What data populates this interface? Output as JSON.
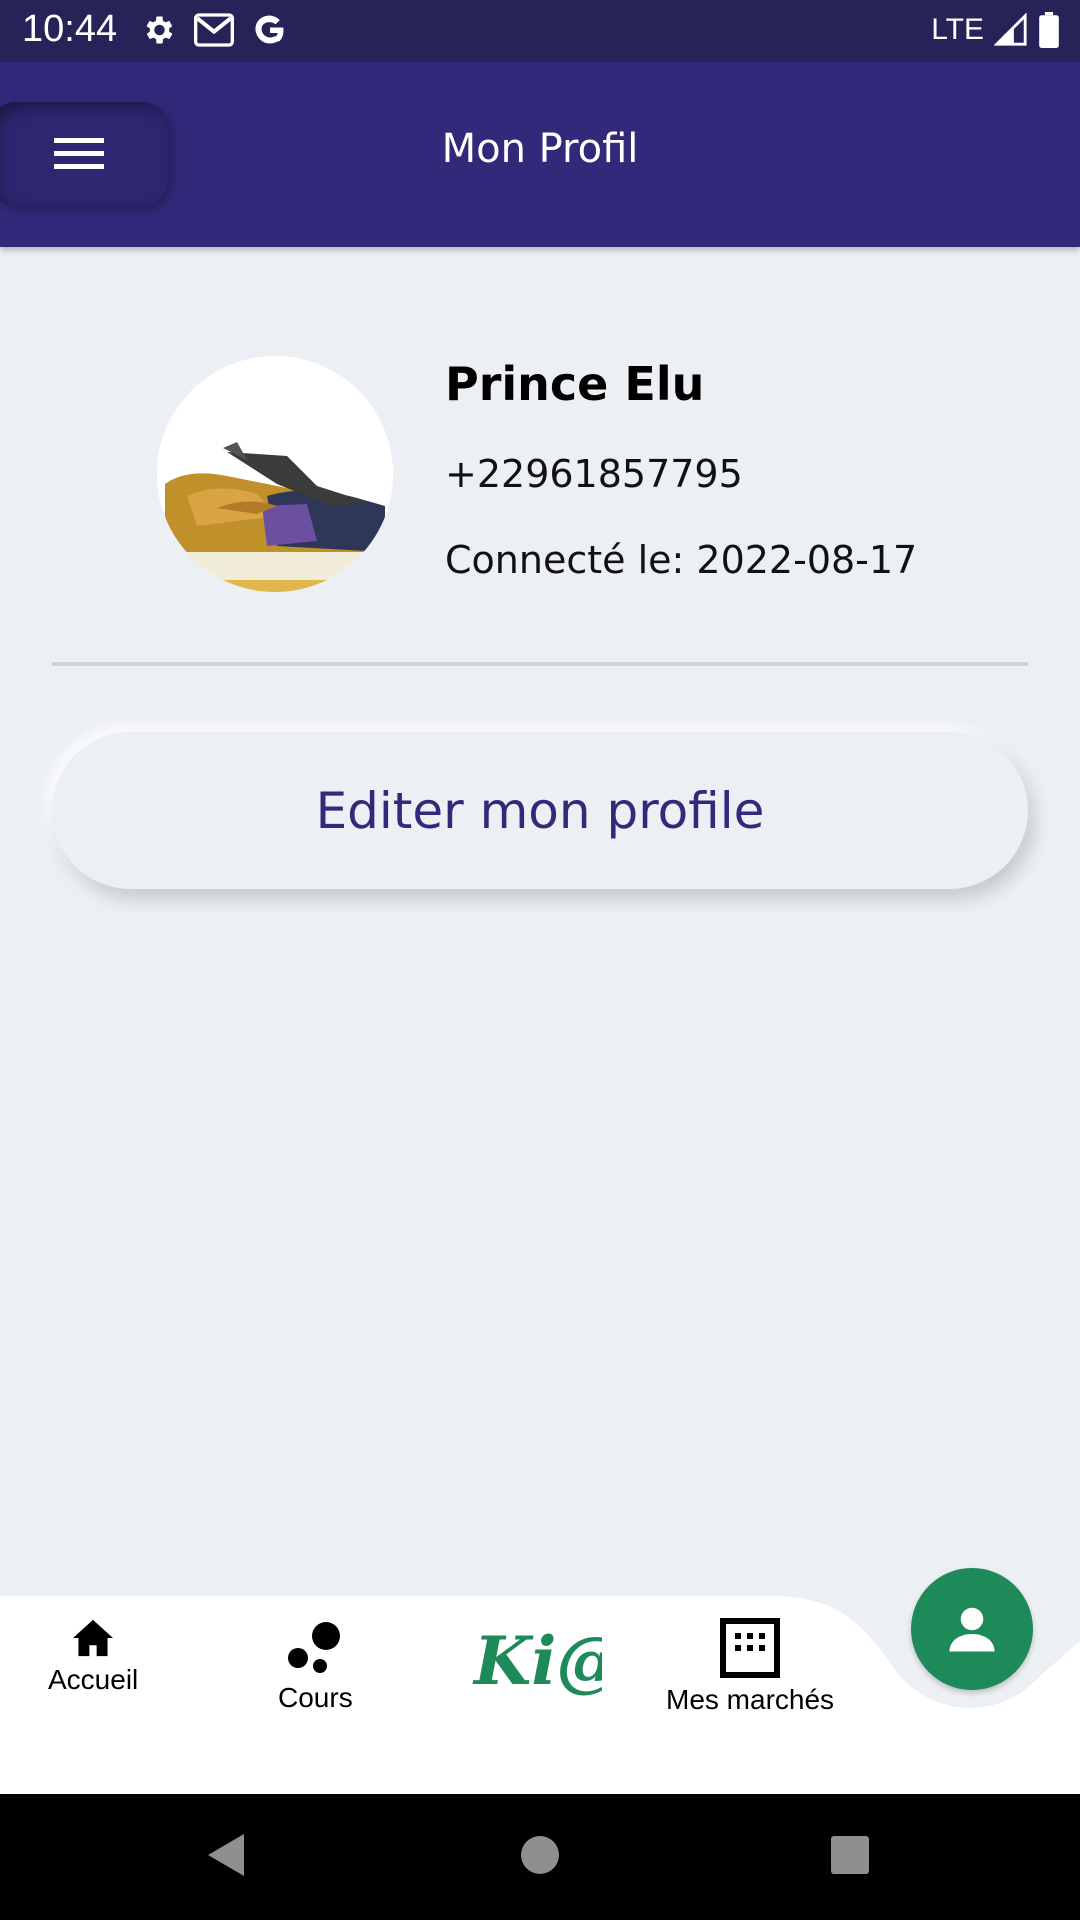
{
  "status_bar": {
    "time": "10:44",
    "network": "LTE",
    "icons_left": [
      "gear-icon",
      "gmail-icon",
      "google-icon"
    ],
    "icons_right": [
      "signal-icon",
      "battery-icon"
    ]
  },
  "app_bar": {
    "title": "Mon Profil",
    "menu_icon": "hamburger-menu-icon",
    "color": "#32297a"
  },
  "profile": {
    "name": "Prince Elu",
    "phone": "+22961857795",
    "connected": "Connecté le: 2022-08-17"
  },
  "edit_button": {
    "label": "Editer mon profile",
    "color": "#32297a"
  },
  "bottom_nav": {
    "items": [
      {
        "label": "Accueil",
        "icon": "home-icon"
      },
      {
        "label": "Cours",
        "icon": "bubbles-icon"
      },
      {
        "label": "Ki@",
        "icon": "kia-logo"
      },
      {
        "label": "Mes marchés",
        "icon": "grid-icon"
      }
    ],
    "fab_icon": "person-icon",
    "fab_color": "#1f8a59"
  },
  "system_nav": [
    "back-icon",
    "home-circle-icon",
    "recents-icon"
  ]
}
